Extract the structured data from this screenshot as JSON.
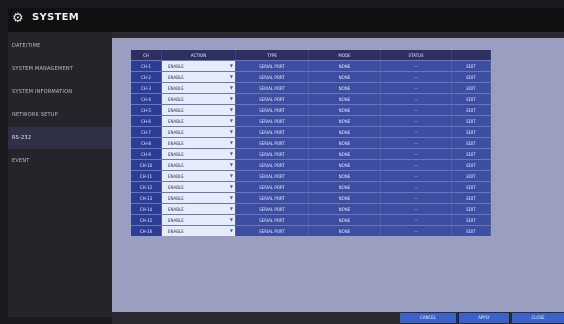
{
  "header": {
    "title": "SYSTEM",
    "icon": "gear-icon"
  },
  "sidebar": {
    "items": [
      {
        "label": "DATE/TIME"
      },
      {
        "label": "SYSTEM MANAGEMENT"
      },
      {
        "label": "SYSTEM INFORMATION"
      },
      {
        "label": "NETWORK SETUP"
      },
      {
        "label": "RS-232"
      },
      {
        "label": "EVENT"
      }
    ],
    "active_index": 4
  },
  "table": {
    "columns": [
      "CH",
      "ACTION",
      "TYPE",
      "MODE",
      "STATUS",
      ""
    ],
    "rows": [
      {
        "ch": "CH-1",
        "action": "ENABLE",
        "type": "SERIAL PORT",
        "mode": "NONE",
        "status": "--",
        "edit": "EDIT"
      },
      {
        "ch": "CH-2",
        "action": "ENABLE",
        "type": "SERIAL PORT",
        "mode": "NONE",
        "status": "--",
        "edit": "EDIT"
      },
      {
        "ch": "CH-3",
        "action": "ENABLE",
        "type": "SERIAL PORT",
        "mode": "NONE",
        "status": "--",
        "edit": "EDIT"
      },
      {
        "ch": "CH-4",
        "action": "ENABLE",
        "type": "SERIAL PORT",
        "mode": "NONE",
        "status": "--",
        "edit": "EDIT"
      },
      {
        "ch": "CH-5",
        "action": "ENABLE",
        "type": "SERIAL PORT",
        "mode": "NONE",
        "status": "--",
        "edit": "EDIT"
      },
      {
        "ch": "CH-6",
        "action": "ENABLE",
        "type": "SERIAL PORT",
        "mode": "NONE",
        "status": "--",
        "edit": "EDIT"
      },
      {
        "ch": "CH-7",
        "action": "ENABLE",
        "type": "SERIAL PORT",
        "mode": "NONE",
        "status": "--",
        "edit": "EDIT"
      },
      {
        "ch": "CH-8",
        "action": "ENABLE",
        "type": "SERIAL PORT",
        "mode": "NONE",
        "status": "--",
        "edit": "EDIT"
      },
      {
        "ch": "CH-9",
        "action": "ENABLE",
        "type": "SERIAL PORT",
        "mode": "NONE",
        "status": "--",
        "edit": "EDIT"
      },
      {
        "ch": "CH-10",
        "action": "ENABLE",
        "type": "SERIAL PORT",
        "mode": "NONE",
        "status": "--",
        "edit": "EDIT"
      },
      {
        "ch": "CH-11",
        "action": "ENABLE",
        "type": "SERIAL PORT",
        "mode": "NONE",
        "status": "--",
        "edit": "EDIT"
      },
      {
        "ch": "CH-12",
        "action": "ENABLE",
        "type": "SERIAL PORT",
        "mode": "NONE",
        "status": "--",
        "edit": "EDIT"
      },
      {
        "ch": "CH-13",
        "action": "ENABLE",
        "type": "SERIAL PORT",
        "mode": "NONE",
        "status": "--",
        "edit": "EDIT"
      },
      {
        "ch": "CH-14",
        "action": "ENABLE",
        "type": "SERIAL PORT",
        "mode": "NONE",
        "status": "--",
        "edit": "EDIT"
      },
      {
        "ch": "CH-15",
        "action": "ENABLE",
        "type": "SERIAL PORT",
        "mode": "NONE",
        "status": "--",
        "edit": "EDIT"
      },
      {
        "ch": "CH-16",
        "action": "ENABLE",
        "type": "SERIAL PORT",
        "mode": "NONE",
        "status": "--",
        "edit": "EDIT"
      }
    ]
  },
  "footer": {
    "cancel_label": "CANCEL",
    "apply_label": "APPLY",
    "close_label": "CLOSE"
  }
}
